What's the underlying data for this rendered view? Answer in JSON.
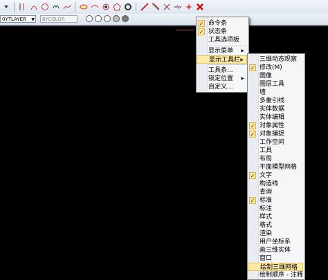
{
  "toolbar": {
    "layer_value": "0YTLAYER",
    "color_value": "BYCOLOR"
  },
  "menu1": {
    "items": [
      {
        "label": "命令条",
        "checked": true
      },
      {
        "label": "状态条",
        "checked": true
      },
      {
        "label": "工具选项板",
        "checked": false
      },
      {
        "label": "显示菜单",
        "checked": false,
        "submenu": true
      },
      {
        "label": "显示工具栏",
        "checked": false,
        "submenu": true,
        "highlighted": true
      },
      {
        "label": "工具条...",
        "checked": false
      },
      {
        "label": "锁定位置",
        "checked": false,
        "submenu": true
      },
      {
        "label": "自定义...",
        "checked": false
      }
    ]
  },
  "menu2": {
    "items": [
      {
        "label": "三维动态观察",
        "checked": false
      },
      {
        "label": "修改(M)",
        "checked": true
      },
      {
        "label": "图像",
        "checked": false
      },
      {
        "label": "图层工具",
        "checked": false
      },
      {
        "label": "墙",
        "checked": false
      },
      {
        "label": "多重引线",
        "checked": false
      },
      {
        "label": "实体数据",
        "checked": false
      },
      {
        "label": "实体编辑",
        "checked": false
      },
      {
        "label": "对象属性",
        "checked": true
      },
      {
        "label": "对象捕捉",
        "checked": true
      },
      {
        "label": "工作空间",
        "checked": false
      },
      {
        "label": "工具",
        "checked": false
      },
      {
        "label": "布局",
        "checked": false
      },
      {
        "label": "平面模型网格",
        "checked": false
      },
      {
        "label": "文字",
        "checked": true
      },
      {
        "label": "构造线",
        "checked": false
      },
      {
        "label": "查询",
        "checked": false
      },
      {
        "label": "标准",
        "checked": true
      },
      {
        "label": "标注",
        "checked": false
      },
      {
        "label": "样式",
        "checked": false
      },
      {
        "label": "格式",
        "checked": false
      },
      {
        "label": "渲染",
        "checked": false
      },
      {
        "label": "用户坐标系",
        "checked": false
      },
      {
        "label": "画三维实体",
        "checked": false
      },
      {
        "label": "窗口",
        "checked": false
      },
      {
        "label": "绘制三维网格",
        "checked": false,
        "highlighted": true
      },
      {
        "label": "绘制顺序 - 注释",
        "checked": false
      }
    ]
  },
  "check_glyph": "✓",
  "arrow_glyph": "▶",
  "colors": {
    "highlight": "#fde9a8",
    "menu_bg": "#f5f6f8",
    "check_bg": "#fbe7a0"
  }
}
